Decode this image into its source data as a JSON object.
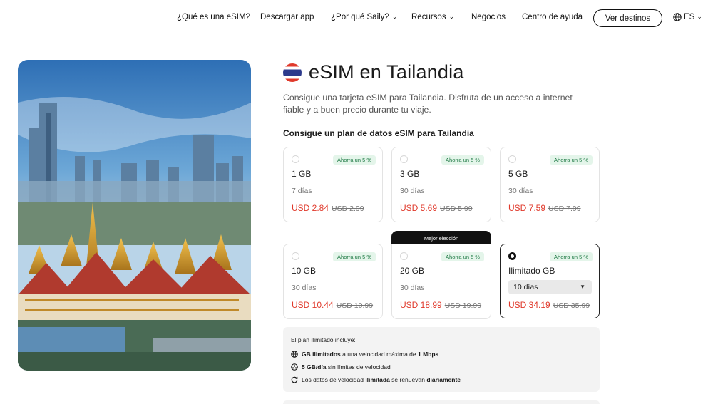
{
  "nav": {
    "items": [
      {
        "label": "¿Qué es una eSIM?",
        "dropdown": false
      },
      {
        "label": "Descargar app",
        "dropdown": false
      },
      {
        "label": "¿Por qué Saily?",
        "dropdown": true
      },
      {
        "label": "Recursos",
        "dropdown": true
      },
      {
        "label": "Negocios",
        "dropdown": false
      },
      {
        "label": "Centro de ayuda",
        "dropdown": false
      }
    ],
    "cta_label": "Ver destinos",
    "language": "ES",
    "globe_icon": "globe-icon",
    "chevron_icon": "chevron-down-icon"
  },
  "hero": {
    "image": "bangkok-grand-palace-skyline-photo"
  },
  "page": {
    "flag": "thailand-flag",
    "title": "eSIM en Tailandia",
    "description": "Consigue una tarjeta eSIM para Tailandia. Disfruta de un acceso a internet fiable y a buen precio durante tu viaje.",
    "plans_heading": "Consigue un plan de datos eSIM para Tailandia"
  },
  "plans": [
    {
      "data": "1 GB",
      "duration": "7 días",
      "price": "USD 2.84",
      "old_price": "USD 2.99",
      "badge": "Ahorra un 5 %",
      "selected": false
    },
    {
      "data": "3 GB",
      "duration": "30 días",
      "price": "USD 5.69",
      "old_price": "USD 5.99",
      "badge": "Ahorra un 5 %",
      "selected": false
    },
    {
      "data": "5 GB",
      "duration": "30 días",
      "price": "USD 7.59",
      "old_price": "USD 7.99",
      "badge": "Ahorra un 5 %",
      "selected": false
    },
    {
      "data": "10 GB",
      "duration": "30 días",
      "price": "USD 10.44",
      "old_price": "USD 10.99",
      "badge": "Ahorra un 5 %",
      "selected": false
    },
    {
      "data": "20 GB",
      "duration": "30 días",
      "price": "USD 18.99",
      "old_price": "USD 19.99",
      "badge": "Ahorra un 5 %",
      "selected": false,
      "ribbon": "Mejor elección"
    },
    {
      "data": "Ilimitado GB",
      "duration": "10 días",
      "price": "USD 34.19",
      "old_price": "USD 35.99",
      "badge": "Ahorra un 5 %",
      "selected": true
    }
  ],
  "unlimited_info": {
    "title": "El plan ilimitado incluye:",
    "rows": [
      {
        "icon": "globe-network-icon",
        "bold": "GB ilimitados",
        "text": " a una velocidad máxima de ",
        "bold2": "1 Mbps",
        "text2": ""
      },
      {
        "icon": "speed-icon",
        "bold": "5 GB/día",
        "text": " sin límites de velocidad",
        "bold2": "",
        "text2": ""
      },
      {
        "icon": "refresh-icon",
        "bold": "",
        "text": "Los datos de velocidad ",
        "bold2": "ilimitada",
        "text2": " se renuevan ",
        "bold3": "diariamente"
      }
    ]
  },
  "colors": {
    "accent_red": "#e0392b",
    "badge_green": "#1f7a45",
    "badge_bg": "#e4f5ea"
  }
}
